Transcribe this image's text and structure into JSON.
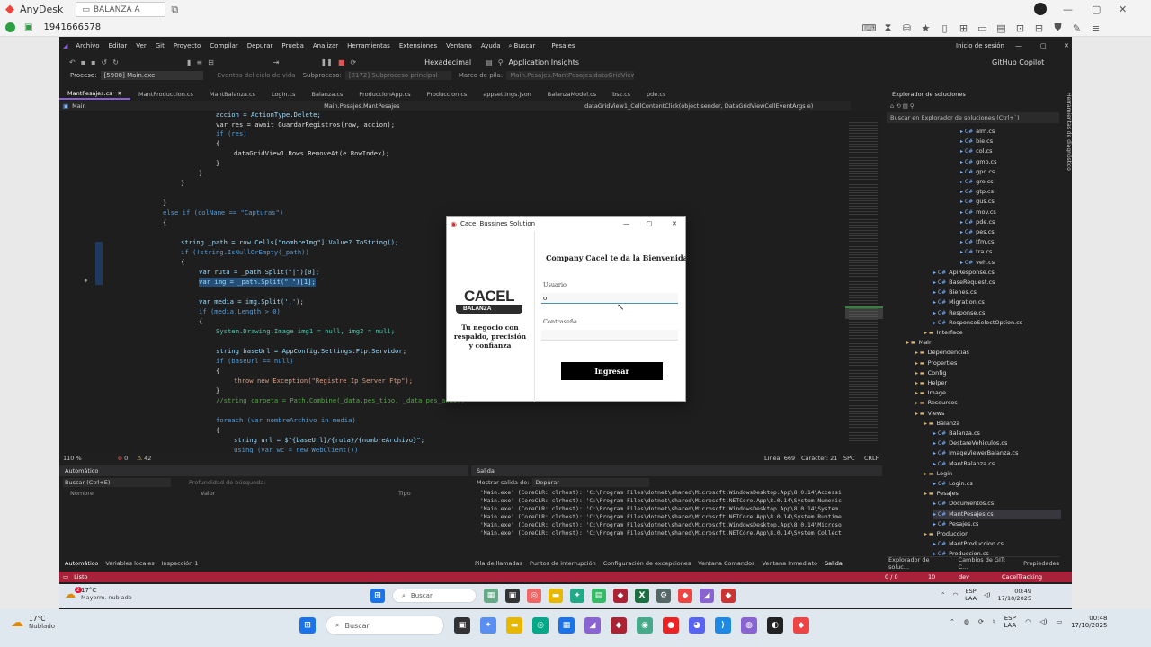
{
  "anydesk": {
    "title": "AnyDesk",
    "tab": "BALANZA A",
    "address": "1941666578"
  },
  "vs": {
    "menu": [
      "Archivo",
      "Editar",
      "Ver",
      "Git",
      "Proyecto",
      "Compilar",
      "Depurar",
      "Prueba",
      "Analizar",
      "Herramientas",
      "Extensiones",
      "Ventana",
      "Ayuda",
      "Buscar",
      "Pesajes"
    ],
    "signin": "Inicio de sesión",
    "copilot": "GitHub Copilot",
    "hex": "Hexadecimal",
    "insights": "Application Insights",
    "process_label": "Proceso:",
    "process_value": "[5908] Main.exe",
    "lifecycle": "Eventos del ciclo de vida",
    "thread": "Subproceso:",
    "thread_value": "[8172] Subproceso principal",
    "stackframe": "Marco de pila:",
    "stackframe_value": "Main.Pesajes.MantPesajes.dataGridView1_...",
    "doc_tabs": [
      "MantPesajes.cs",
      "MantProduccion.cs",
      "MantBalanza.cs",
      "Login.cs",
      "Balanza.cs",
      "ProduccionApp.cs",
      "Produccion.cs",
      "appsettings.json",
      "BalanzaModel.cs",
      "bsz.cs",
      "pde.cs"
    ],
    "nav_left": "Main",
    "nav_mid": "Main.Pesajes.MantPesajes",
    "nav_right": "dataGridView1_CellContentClick(object sender, DataGridViewCellEventArgs e)",
    "zoom": "110 %",
    "errors": "0",
    "warnings": "42",
    "line": "Línea: 669",
    "char": "Carácter: 21",
    "spc": "SPC",
    "crlf": "CRLF",
    "status_ready": "Listo",
    "status_right": [
      "0 / 0",
      "10",
      "dev",
      "CacelTracking"
    ]
  },
  "code": [
    "accion = ActionType.Delete;",
    "var res = await GuardarRegistros(row, accion);",
    "if (res)",
    "{",
    "dataGridView1.Rows.RemoveAt(e.RowIndex);",
    "}",
    "}",
    "}",
    "",
    "}",
    "else if (colName == \"Capturas\")",
    "{",
    "",
    "string _path = row.Cells[\"nombreImg\"].Value?.ToString();",
    "if (!string.IsNullOrEmpty(_path))",
    "{",
    "var ruta = _path.Split(\"|\")[0];",
    "var img = _path.Split(\"|\")[1];",
    "",
    "var media = img.Split(',');",
    "if (media.Length > 0)",
    "{",
    "System.Drawing.Image img1 = null, img2 = null;",
    "",
    "string baseUrl = AppConfig.Settings.Ftp.Servidor;",
    "if (baseUrl == null)",
    "{",
    "throw new Exception(\"Registre Ip Server Ftp\");",
    "}",
    "//string carpeta = Path.Combine(_data.pes_tipo, _data.pes_anio);",
    "",
    "foreach (var nombreArchivo in media)",
    "{",
    "string url = $\"{baseUrl}/{ruta}/{nombreArchivo}\";",
    "using (var wc = new WebClient())"
  ],
  "solution": {
    "title": "Explorador de soluciones",
    "search": "Buscar en Explorador de soluciones (Ctrl+`)",
    "items": [
      "alm.cs",
      "bie.cs",
      "col.cs",
      "gmo.cs",
      "gpo.cs",
      "gro.cs",
      "gtp.cs",
      "gus.cs",
      "mov.cs",
      "pde.cs",
      "pes.cs",
      "tfm.cs",
      "tra.cs",
      "veh.cs",
      "ApiResponse.cs",
      "BaseRequest.cs",
      "Bienes.cs",
      "Migration.cs",
      "Response.cs",
      "ResponseSelectOption.cs",
      "Interface",
      "Main",
      "Dependencias",
      "Properties",
      "Config",
      "Helper",
      "Image",
      "Resources",
      "Views",
      "Balanza",
      "Balanza.cs",
      "DestareVehiculos.cs",
      "ImageViewerBalanza.cs",
      "MantBalanza.cs",
      "Login",
      "Login.cs",
      "Pesajes",
      "Documentos.cs",
      "MantPesajes.cs",
      "Pesajes.cs",
      "Produccion",
      "MantProduccion.cs",
      "Produccion.cs"
    ],
    "bottom_tabs": [
      "Explorador de soluc...",
      "Cambios de GIT: C...",
      "Propiedades"
    ],
    "side_label": "Herramientas de diagnóstico"
  },
  "auto": {
    "title": "Automático",
    "search": "Buscar (Ctrl+E)",
    "depth": "Profundidad de búsqueda:",
    "cols": [
      "Nombre",
      "Valor",
      "Tipo"
    ],
    "tabs": [
      "Automático",
      "Variables locales",
      "Inspección 1"
    ]
  },
  "output": {
    "title": "Salida",
    "show_from": "Mostrar salida de:",
    "source": "Depurar",
    "lines": [
      "'Main.exe' (CoreCLR: clrhost): 'C:\\Program Files\\dotnet\\shared\\Microsoft.WindowsDesktop.App\\8.0.14\\Accessi",
      "'Main.exe' (CoreCLR: clrhost): 'C:\\Program Files\\dotnet\\shared\\Microsoft.NETCore.App\\8.0.14\\System.Numeric",
      "'Main.exe' (CoreCLR: clrhost): 'C:\\Program Files\\dotnet\\shared\\Microsoft.WindowsDesktop.App\\8.0.14\\System.",
      "'Main.exe' (CoreCLR: clrhost): 'C:\\Program Files\\dotnet\\shared\\Microsoft.NETCore.App\\8.0.14\\System.Runtime",
      "'Main.exe' (CoreCLR: clrhost): 'C:\\Program Files\\dotnet\\shared\\Microsoft.WindowsDesktop.App\\8.0.14\\Microso",
      "'Main.exe' (CoreCLR: clrhost): 'C:\\Program Files\\dotnet\\shared\\Microsoft.NETCore.App\\8.0.14\\System.Collect"
    ],
    "tabs": [
      "Pila de llamadas",
      "Puntos de interrupción",
      "Configuración de excepciones",
      "Ventana Comandos",
      "Ventana Inmediato",
      "Salida"
    ]
  },
  "dialog": {
    "title": "Cacel Bussines Solution",
    "logo_main": "CACEL",
    "logo_sub": "BALANZA",
    "tagline": "Tu negocio con respaldo, precisión y confianza",
    "welcome": "Company Cacel te da la Bienvenida",
    "user_label": "Usuario",
    "user_value": "o",
    "pass_label": "Contraseña",
    "button": "Ingresar"
  },
  "taskbar_inner": {
    "weather_temp": "17°C",
    "weather_desc": "Mayorm. nublado",
    "search": "Buscar",
    "lang": "ESP",
    "lang2": "LAA",
    "time": "00:49",
    "date": "17/10/2025",
    "badge": "2"
  },
  "taskbar_outer": {
    "weather_temp": "17°C",
    "weather_desc": "Nublado",
    "search": "Buscar",
    "lang": "ESP",
    "lang2": "LAA",
    "time": "00:48",
    "date": "17/10/2025"
  },
  "colors": {
    "vs_status": "#a8213a",
    "anydesk_red": "#ef443b",
    "accent": "#8a63d2"
  }
}
